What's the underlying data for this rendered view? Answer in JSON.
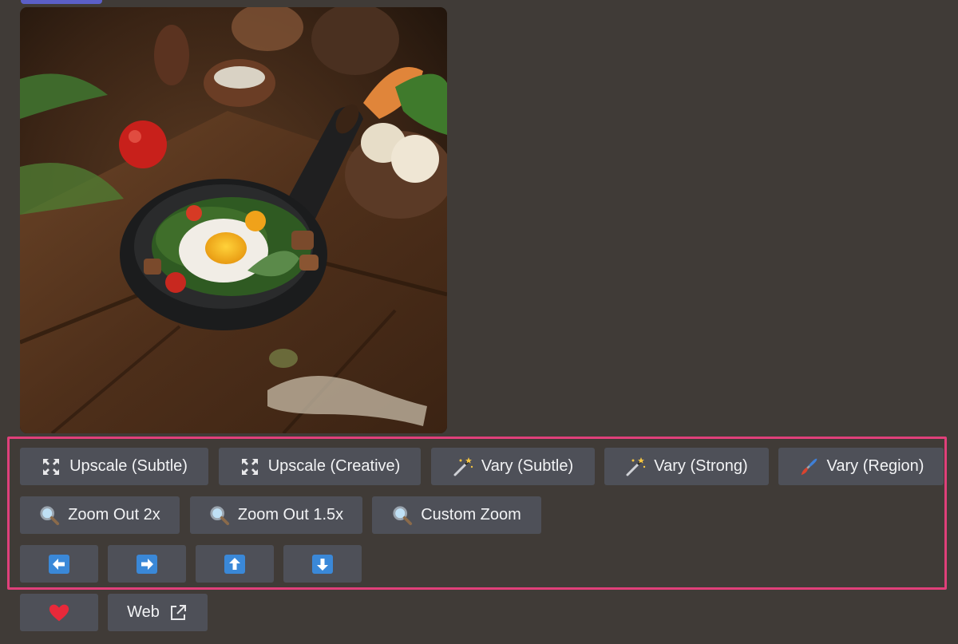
{
  "image": {
    "alt": ""
  },
  "buttons": {
    "upscale_subtle": "Upscale (Subtle)",
    "upscale_creative": "Upscale (Creative)",
    "vary_subtle": "Vary (Subtle)",
    "vary_strong": "Vary (Strong)",
    "vary_region": "Vary (Region)",
    "zoom_out_2x": "Zoom Out 2x",
    "zoom_out_15x": "Zoom Out 1.5x",
    "custom_zoom": "Custom Zoom",
    "web": "Web"
  },
  "icons": {
    "upscale": "expand-arrows-icon",
    "vary": "magic-wand-icon",
    "region": "paintbrush-icon",
    "zoom": "magnifier-icon",
    "pan_left": "arrow-left-icon",
    "pan_right": "arrow-right-icon",
    "pan_up": "arrow-up-icon",
    "pan_down": "arrow-down-icon",
    "favorite": "heart-icon",
    "external": "external-link-icon"
  },
  "colors": {
    "background": "#403b37",
    "button": "#4e5058",
    "highlight": "#e0407a",
    "arrow_tile": "#3a88d8",
    "heart": "#e8293a"
  }
}
